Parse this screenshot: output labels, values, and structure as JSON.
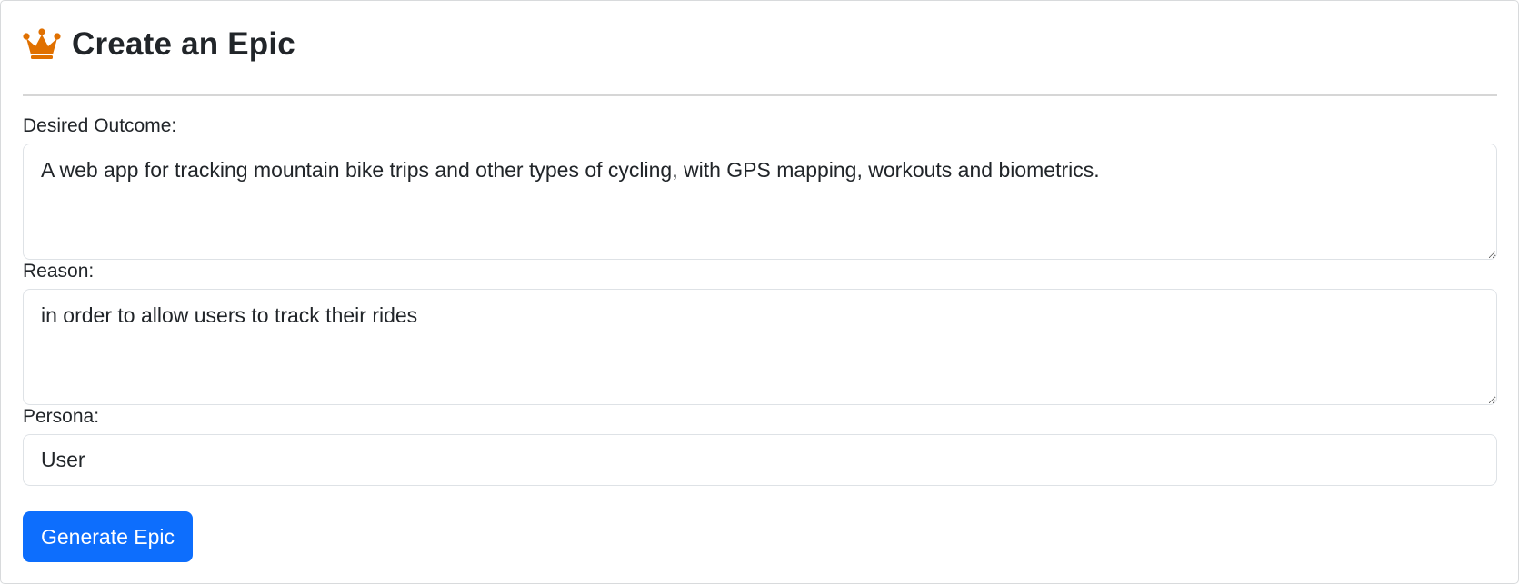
{
  "header": {
    "title": "Create an Epic",
    "icon": "crown-icon",
    "icon_color": "#e07000"
  },
  "form": {
    "desired_outcome": {
      "label": "Desired Outcome:",
      "value": "A web app for tracking mountain bike trips and other types of cycling, with GPS mapping, workouts and biometrics."
    },
    "reason": {
      "label": "Reason:",
      "value": "in order to allow users to track their rides"
    },
    "persona": {
      "label": "Persona:",
      "value": "User"
    },
    "submit_label": "Generate Epic"
  },
  "colors": {
    "primary": "#0d6efd",
    "text": "#212529",
    "border": "#dee2e6"
  }
}
